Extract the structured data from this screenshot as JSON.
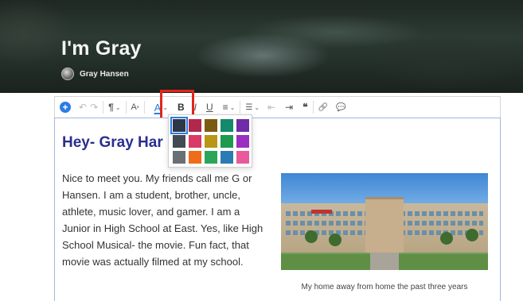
{
  "banner": {
    "title": "I'm Gray",
    "author": "Gray Hansen"
  },
  "toolbar": {
    "buttons": [
      {
        "name": "insert",
        "glyph": "+"
      },
      {
        "name": "undo",
        "glyph": "↶"
      },
      {
        "name": "redo",
        "glyph": "↷"
      },
      {
        "name": "paragraph",
        "glyph": "¶"
      },
      {
        "name": "text-size",
        "glyph": "A"
      },
      {
        "name": "text-color",
        "glyph": "A"
      },
      {
        "name": "bold",
        "glyph": "B"
      },
      {
        "name": "italic",
        "glyph": "I"
      },
      {
        "name": "underline",
        "glyph": "U"
      },
      {
        "name": "align",
        "glyph": "≡"
      },
      {
        "name": "list",
        "glyph": "☰"
      },
      {
        "name": "outdent",
        "glyph": "⇤"
      },
      {
        "name": "indent",
        "glyph": "⇥"
      },
      {
        "name": "quote",
        "glyph": "❝"
      },
      {
        "name": "link",
        "glyph": "🔗"
      },
      {
        "name": "comment",
        "glyph": "💬"
      }
    ]
  },
  "editor": {
    "heading": "Hey- Gray Har",
    "paragraph": "Nice to meet you. My friends call me G or Hansen. I am a student, brother, uncle, athlete, music lover, and gamer. I am a Junior in High School at East. Yes, like High School Musical- the movie. Fun fact, that movie was actually filmed at my school.",
    "caption": "My home away from home the past three years"
  },
  "color_swatches": [
    "#2d3748",
    "#b3274c",
    "#7a5b12",
    "#138a6a",
    "#6f2ba8",
    "#444a53",
    "#d93a66",
    "#b89618",
    "#1f9a4e",
    "#9b2fc2",
    "#6a6f76",
    "#ef6c1a",
    "#2aa55a",
    "#2a7ab5",
    "#e85a9c"
  ],
  "selected_swatch": 0
}
